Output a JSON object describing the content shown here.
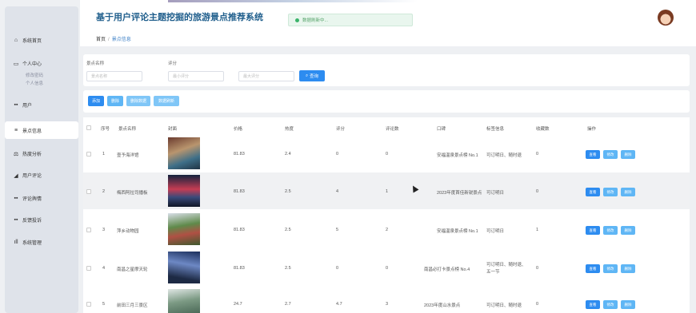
{
  "app": {
    "title": "基于用户评论主题挖掘的旅游景点推荐系统"
  },
  "toast": {
    "text": "数据刷新中..."
  },
  "breadcrumb": {
    "home": "首页",
    "current": "景点信息"
  },
  "sidebar": {
    "items": [
      {
        "label": "系统首页",
        "icon": "home-icon"
      },
      {
        "label": "个人中心",
        "icon": "user-icon"
      },
      {
        "label": "用户",
        "icon": "grid-icon"
      },
      {
        "label": "景点信息",
        "icon": "menu-icon"
      },
      {
        "label": "热度分析",
        "icon": "analysis-icon"
      },
      {
        "label": "用户评论",
        "icon": "comment-icon"
      },
      {
        "label": "评论舆情",
        "icon": "grid-icon"
      },
      {
        "label": "反馈投诉",
        "icon": "grid-icon"
      },
      {
        "label": "系统管理",
        "icon": "bar-chart-icon"
      }
    ],
    "subitems": [
      {
        "label": "修改密码"
      },
      {
        "label": "个人信息"
      }
    ]
  },
  "search": {
    "name_label": "景点名称",
    "name_placeholder": "景点名称",
    "score_label": "评分",
    "score_min_placeholder": "最小评分",
    "score_max_placeholder": "最大评分",
    "search_button": "查询"
  },
  "toolbar": {
    "add": "添加",
    "delete": "删除",
    "import_data": "删除数据",
    "export_data": "数据刷新"
  },
  "table": {
    "headers": [
      "序号",
      "景点名称",
      "封面",
      "价格",
      "热度",
      "评分",
      "评论数",
      "口碑",
      "标签信息",
      "收藏数",
      "操作"
    ],
    "actions": {
      "view": "查看",
      "edit": "修改",
      "delete": "删除"
    },
    "rows": [
      {
        "index": "1",
        "name": "壹予海洋馆",
        "price": "81.83",
        "heat": "2.4",
        "score": "0",
        "comments": "0",
        "reputation": "安福温泉景点榜 No.1",
        "tags": "可订明日、随时退",
        "favorites": "0"
      },
      {
        "index": "2",
        "name": "梅西阿拉司播板",
        "price": "81.83",
        "heat": "2.5",
        "score": "4",
        "comments": "1",
        "reputation": "2023年度首佳新锐景点",
        "tags": "可订明日",
        "favorites": "0"
      },
      {
        "index": "3",
        "name": "萍乡动物园",
        "price": "81.83",
        "heat": "2.5",
        "score": "5",
        "comments": "2",
        "reputation": "安福温泉景点榜 No.1",
        "tags": "可订明日",
        "favorites": "1"
      },
      {
        "index": "4",
        "name": "南昌之星摩天轮",
        "price": "81.83",
        "heat": "2.5",
        "score": "0",
        "comments": "0",
        "reputation": "南昌必打卡景点榜 No.4",
        "tags": "可订明日、随时退、五一节",
        "favorites": "0"
      },
      {
        "index": "5",
        "name": "前田三月三景区",
        "price": "24.7",
        "heat": "2.7",
        "score": "4.7",
        "comments": "3",
        "reputation": "2023年度山水景点",
        "tags": "可订明日、随时退",
        "favorites": "0"
      }
    ]
  },
  "colors": {
    "primary": "#2d8cf0",
    "accent": "#5fb6f5",
    "brand_title": "#1f5e8c"
  }
}
